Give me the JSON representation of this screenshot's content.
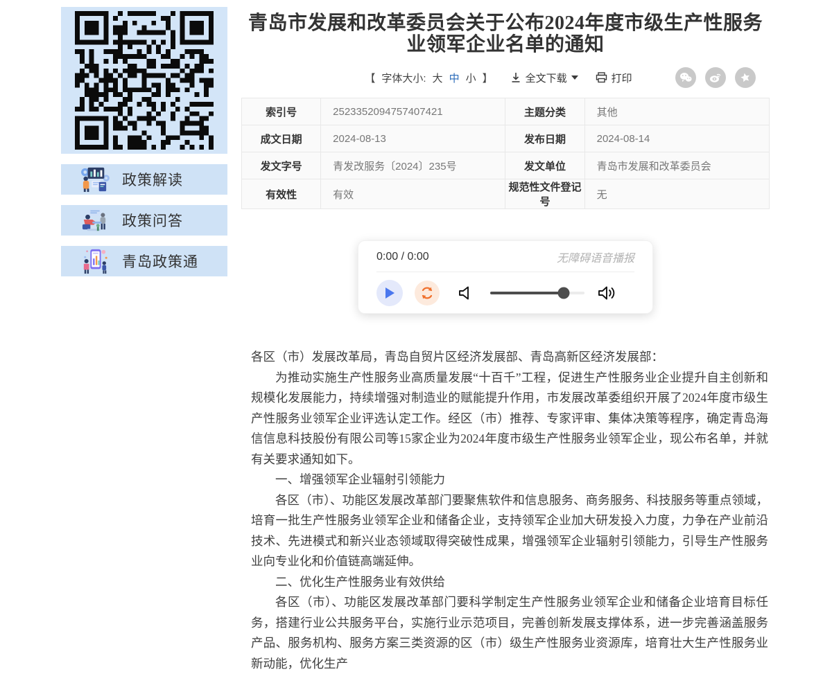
{
  "header": {
    "title": "青岛市发展和改革委员会关于公布2024年度市级生产性服务业领军企业名单的通知"
  },
  "toolbar": {
    "bracket_open": "【",
    "font_size_label": "字体大小:",
    "size_large": "大",
    "size_medium": "中",
    "size_small": "小",
    "selected_size": "中",
    "bracket_close": "】",
    "download_label": "全文下载",
    "print_label": "打印"
  },
  "sidebar": {
    "buttons": [
      {
        "label": "政策解读"
      },
      {
        "label": "政策问答"
      },
      {
        "label": "青岛政策通"
      }
    ]
  },
  "meta_table": {
    "rows": [
      [
        {
          "label": "索引号",
          "value": "2523352094757407421"
        },
        {
          "label": "主题分类",
          "value": "其他"
        }
      ],
      [
        {
          "label": "成文日期",
          "value": "2024-08-13"
        },
        {
          "label": "发布日期",
          "value": "2024-08-14"
        }
      ],
      [
        {
          "label": "发文字号",
          "value": "青发改服务〔2024〕235号"
        },
        {
          "label": "发文单位",
          "value": "青岛市发展和改革委员会"
        }
      ],
      [
        {
          "label": "有效性",
          "value": "有效"
        },
        {
          "label": "规范性文件登记号",
          "value": "无"
        }
      ]
    ]
  },
  "audio_player": {
    "time": "0:00 / 0:00",
    "caption": "无障碍语音播报",
    "volume_percent": 78
  },
  "article": {
    "paragraphs": [
      {
        "text": "各区（市）发展改革局，青岛自贸片区经济发展部、青岛高新区经济发展部："
      },
      {
        "text": "为推动实施生产性服务业高质量发展“十百千”工程，促进生产性服务业企业提升自主创新和规模化发展能力，持续增强对制造业的赋能提升作用，市发展改革委组织开展了2024年度市级生产性服务业领军企业评选认定工作。经区（市）推荐、专家评审、集体决策等程序，确定青岛海信信息科技股份有限公司等15家企业为2024年度市级生产性服务业领军企业，现公布名单，并就有关要求通知如下。"
      },
      {
        "text": "一、增强领军企业辐射引领能力"
      },
      {
        "text": "各区（市）、功能区发展改革部门要聚焦软件和信息服务、商务服务、科技服务等重点领域，培育一批生产性服务业领军企业和储备企业，支持领军企业加大研发投入力度，力争在产业前沿技术、先进模式和新兴业态领域取得突破性成果，增强领军企业辐射引领能力，引导生产性服务业向专业化和价值链高端延伸。"
      },
      {
        "text": "二、优化生产性服务业有效供给"
      },
      {
        "text": "各区（市）、功能区发展改革部门要科学制定生产性服务业领军企业和储备企业培育目标任务，搭建行业公共服务平台，实施行业示范项目，完善创新发展支撑体系，进一步完善涵盖服务产品、服务机构、服务方案三类资源的区（市）级生产性服务业资源库，培育壮大生产性服务业新动能，优化生产"
      }
    ]
  },
  "colors": {
    "panel_blue": "#d3e5f8",
    "button_blue": "#cfe2f6",
    "accent_blue": "#2a6bb9",
    "play_blue": "#4a77ee",
    "loop_orange": "#f0702c",
    "share_icon_grey": "#c9c9c9",
    "body_text": "#404040"
  }
}
